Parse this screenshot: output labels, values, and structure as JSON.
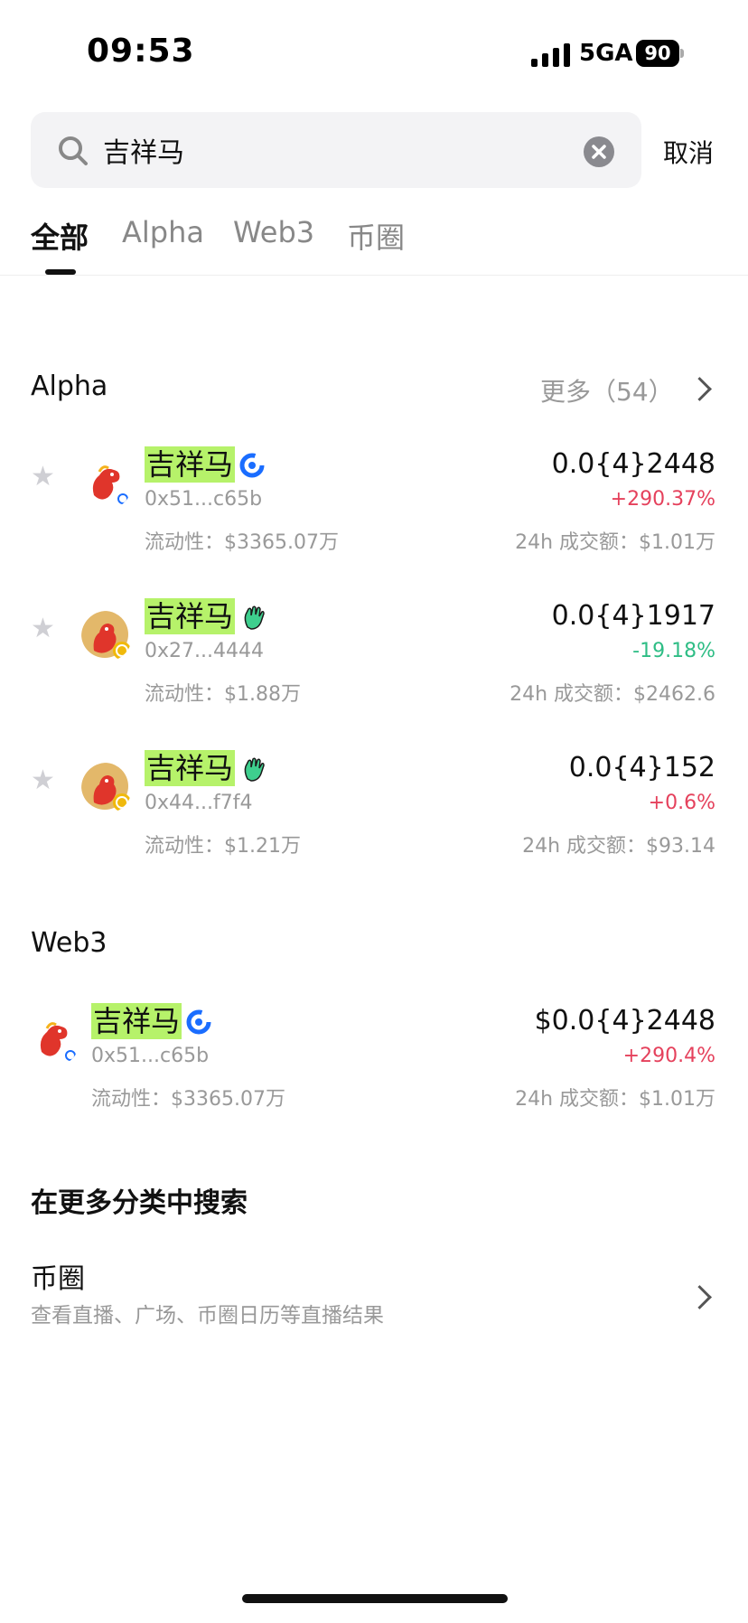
{
  "status_bar": {
    "time": "09:53",
    "network": "5GA",
    "battery": "90"
  },
  "search": {
    "query": "吉祥马",
    "cancel_label": "取消"
  },
  "tabs": [
    {
      "label": "全部",
      "active": true
    },
    {
      "label": "Alpha",
      "active": false
    },
    {
      "label": "Web3",
      "active": false
    },
    {
      "label": "币圈",
      "active": false
    }
  ],
  "alpha": {
    "title": "Alpha",
    "more_label": "更多（54）",
    "items": [
      {
        "name": "吉祥马",
        "address": "0x51...c65b",
        "liquidity": "流动性：$3365.07万",
        "price": "0.0{4}2448",
        "change": "+290.37%",
        "volume": "24h 成交额：$1.01万",
        "badge": "refresh-badge-icon",
        "trend": "up"
      },
      {
        "name": "吉祥马",
        "address": "0x27...4444",
        "liquidity": "流动性：$1.88万",
        "price": "0.0{4}1917",
        "change": "-19.18%",
        "volume": "24h 成交额：$2462.6",
        "badge": "hand-badge-icon",
        "trend": "down"
      },
      {
        "name": "吉祥马",
        "address": "0x44...f7f4",
        "liquidity": "流动性：$1.21万",
        "price": "0.0{4}152",
        "change": "+0.6%",
        "volume": "24h 成交额：$93.14",
        "badge": "hand-badge-icon",
        "trend": "up"
      }
    ]
  },
  "web3": {
    "title": "Web3",
    "items": [
      {
        "name": "吉祥马",
        "address": "0x51...c65b",
        "liquidity": "流动性：$3365.07万",
        "price": "$0.0{4}2448",
        "change": "+290.4%",
        "volume": "24h 成交额：$1.01万",
        "badge": "refresh-badge-icon",
        "trend": "up"
      }
    ]
  },
  "more_categories": {
    "title": "在更多分类中搜索",
    "item_title": "币圈",
    "item_subtitle": "查看直播、广场、币圈日历等直播结果"
  },
  "colors": {
    "highlight": "#b6f26a",
    "up": "#e5415c",
    "down": "#2ebd85",
    "badge_blue": "#1a6dff"
  }
}
